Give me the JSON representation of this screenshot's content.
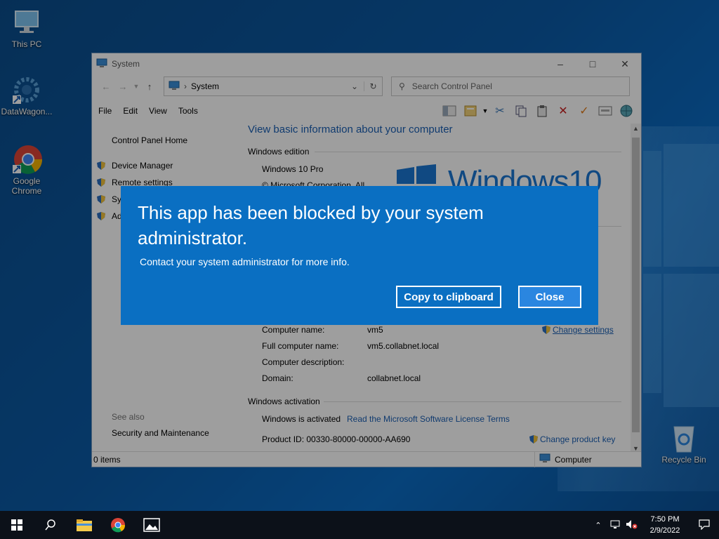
{
  "desktop": {
    "icons": [
      {
        "label": "This PC"
      },
      {
        "label": "DataWagon..."
      },
      {
        "label": "Google Chrome"
      },
      {
        "label": "Recycle Bin"
      }
    ]
  },
  "window": {
    "title": "System",
    "address": {
      "crumb": "System"
    },
    "search": {
      "placeholder": "Search Control Panel"
    },
    "menu": [
      "File",
      "Edit",
      "View",
      "Tools"
    ],
    "left_pane": {
      "home": "Control Panel Home",
      "items": [
        "Device Manager",
        "Remote settings",
        "Sy",
        "Ad"
      ],
      "see_also": "See also",
      "security": "Security and Maintenance"
    },
    "content": {
      "heading": "View basic information about your computer",
      "windows_edition": "Windows edition",
      "edition_name": "Windows 10 Pro",
      "copyright": "© Microsoft Corporation. All",
      "logo_text": "Windows10",
      "computer_name_label": "Computer name:",
      "computer_name": "vm5",
      "full_name_label": "Full computer name:",
      "full_name": "vm5.collabnet.local",
      "description_label": "Computer description:",
      "domain_label": "Domain:",
      "domain": "collabnet.local",
      "change_settings": "Change settings",
      "activation_header": "Windows activation",
      "activated": "Windows is activated",
      "license_link": "Read the Microsoft Software License Terms",
      "product_id": "Product ID: 00330-80000-00000-AA690",
      "change_key": "Change product key"
    },
    "status": {
      "items": "0 items",
      "location": "Computer"
    }
  },
  "dialog": {
    "title": "This app has been blocked by your system administrator.",
    "message": "Contact your system administrator for more info.",
    "copy_label": "Copy to clipboard",
    "close_label": "Close"
  },
  "taskbar": {
    "time": "7:50 PM",
    "date": "2/9/2022"
  }
}
